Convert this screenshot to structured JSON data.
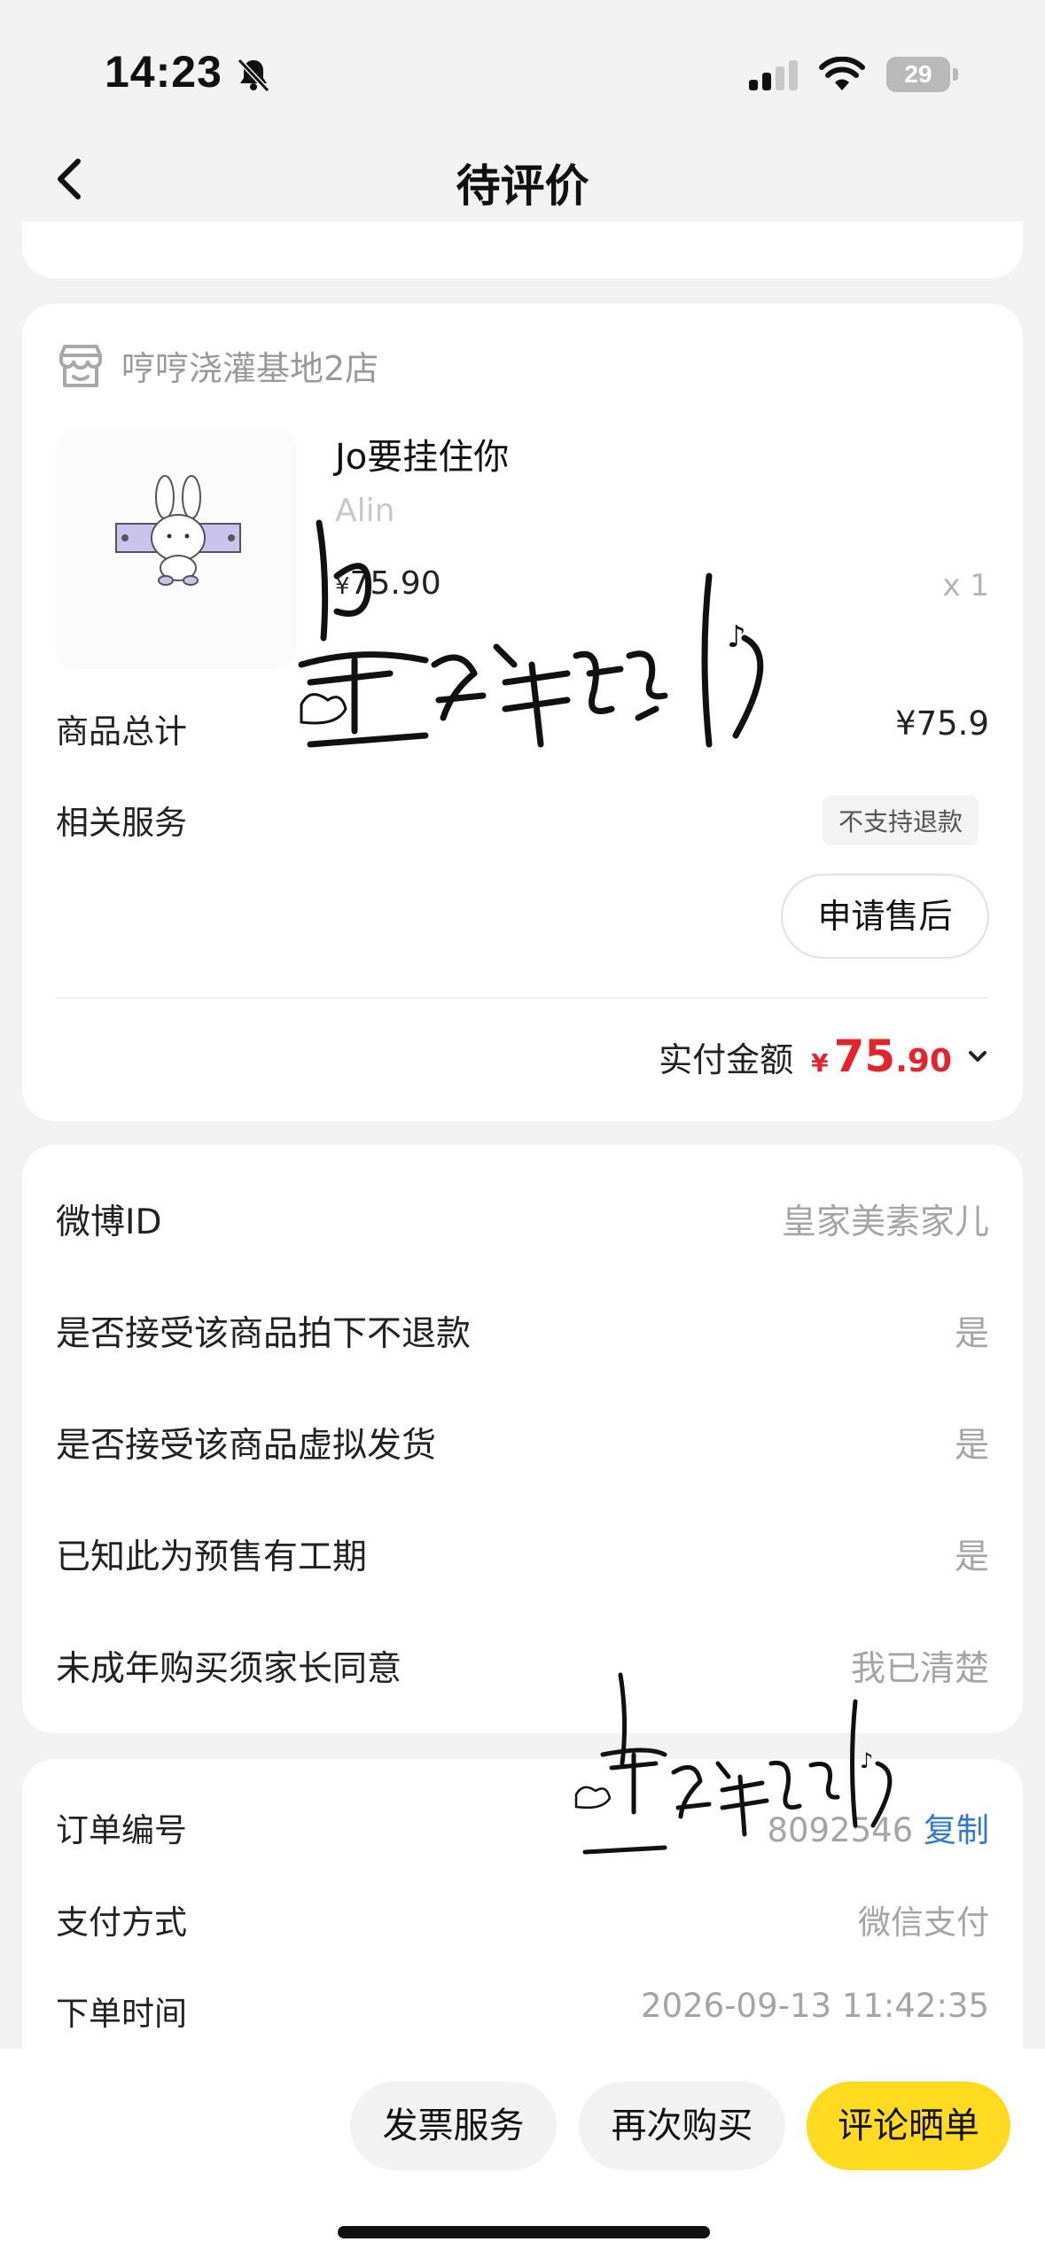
{
  "status_bar": {
    "time": "14:23",
    "battery": "29"
  },
  "nav": {
    "title": "待评价"
  },
  "order_card": {
    "shop_name": "哼哼浇灌基地2店",
    "product": {
      "title": "Jo要挂住你",
      "subtitle": "Alin",
      "price_symbol": "¥",
      "price": "75.90",
      "quantity": "x 1"
    },
    "goods_total_label": "商品总计",
    "goods_total_value": "¥75.9",
    "service_label": "相关服务",
    "service_tag": "不支持退款",
    "after_sale_button": "申请售后",
    "paid_label": "实付金额",
    "paid_symbol": "¥",
    "paid_int": "75",
    "paid_dec": ".90"
  },
  "info_card": {
    "rows": [
      {
        "label": "微博ID",
        "value": "皇家美素家儿"
      },
      {
        "label": "是否接受该商品拍下不退款",
        "value": "是"
      },
      {
        "label": "是否接受该商品虚拟发货",
        "value": "是"
      },
      {
        "label": "已知此为预售有工期",
        "value": "是"
      },
      {
        "label": "未成年购买须家长同意",
        "value": "我已清楚"
      }
    ]
  },
  "meta_card": {
    "order_no_label": "订单编号",
    "order_no_value": "8092546",
    "copy_label": "复制",
    "pay_method_label": "支付方式",
    "pay_method_value": "微信支付",
    "order_time_label": "下单时间",
    "order_time_value": "2026-09-13 11:42:35"
  },
  "bottom_bar": {
    "invoice": "发票服务",
    "rebuy": "再次购买",
    "review": "评论晒单"
  },
  "watermark": "皇家美素家儿",
  "colors": {
    "accent_yellow": "#ffdb1f",
    "price_red": "#e8222a",
    "link_blue": "#2f78d6"
  }
}
